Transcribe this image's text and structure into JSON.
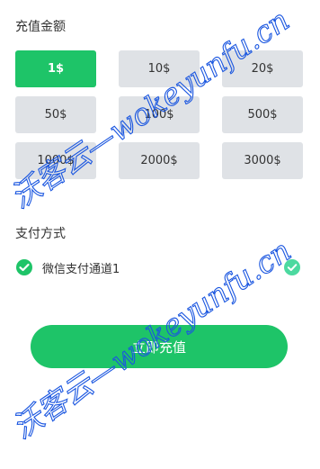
{
  "amount_section": {
    "title": "充值金额",
    "options": [
      "1$",
      "10$",
      "20$",
      "50$",
      "100$",
      "500$",
      "1000$",
      "2000$",
      "3000$"
    ],
    "selected_index": 0
  },
  "payment_section": {
    "title": "支付方式",
    "methods": [
      {
        "label": "微信支付通道1",
        "icon": "wechat-icon",
        "selected": true
      }
    ]
  },
  "submit": {
    "label": "立即充值"
  },
  "watermark": {
    "text": "沃客云—wokeyunfu.cn"
  },
  "colors": {
    "accent": "#1ec468",
    "option_bg": "#dfe2e6",
    "check": "#4cd9a0",
    "watermark": "#1a56e0"
  }
}
